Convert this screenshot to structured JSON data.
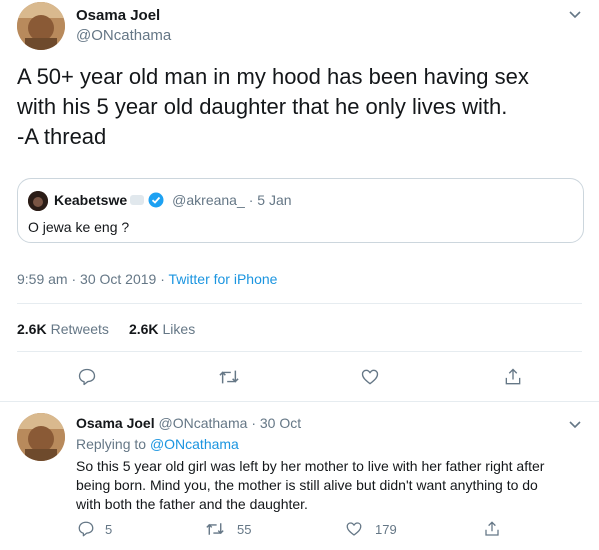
{
  "main_tweet": {
    "author_name": "Osama Joel",
    "author_handle": "@ONcathama",
    "text_line1": "A 50+ year old man in my hood has been having sex",
    "text_line2": "with his 5 year old daughter that he only lives with.",
    "text_line3": "-A thread",
    "quoted": {
      "author_name": "Keabetswe",
      "author_handle": "@akreana_",
      "date": "· 5 Jan",
      "text": "O jewa ke eng ?"
    },
    "time": "9:59 am · 30 Oct 2019",
    "source": "Twitter for iPhone",
    "retweets_count": "2.6K",
    "retweets_label": "Retweets",
    "likes_count": "2.6K",
    "likes_label": "Likes"
  },
  "reply_tweet": {
    "author_name": "Osama Joel",
    "author_handle": "@ONcathama",
    "date": "· 30 Oct",
    "replying_to_label": "Replying to",
    "replying_to_handle": "@ONcathama",
    "text_line1": "So this 5 year old girl was left by her mother to live with her father right after",
    "text_line2": "being born. Mind you, the mother is still alive but didn't want anything to do",
    "text_line3": "with both the father and the daughter.",
    "reply_count": "5",
    "retweet_count": "55",
    "like_count": "179"
  },
  "icons": {
    "reply": "reply-icon",
    "retweet": "retweet-icon",
    "like": "heart-icon",
    "share": "share-icon",
    "more": "chevron-down-icon",
    "verified": "verified-badge-icon"
  },
  "colors": {
    "link": "#1b95e0",
    "muted": "#657786",
    "text": "#14171a",
    "verified": "#1da1f2"
  }
}
